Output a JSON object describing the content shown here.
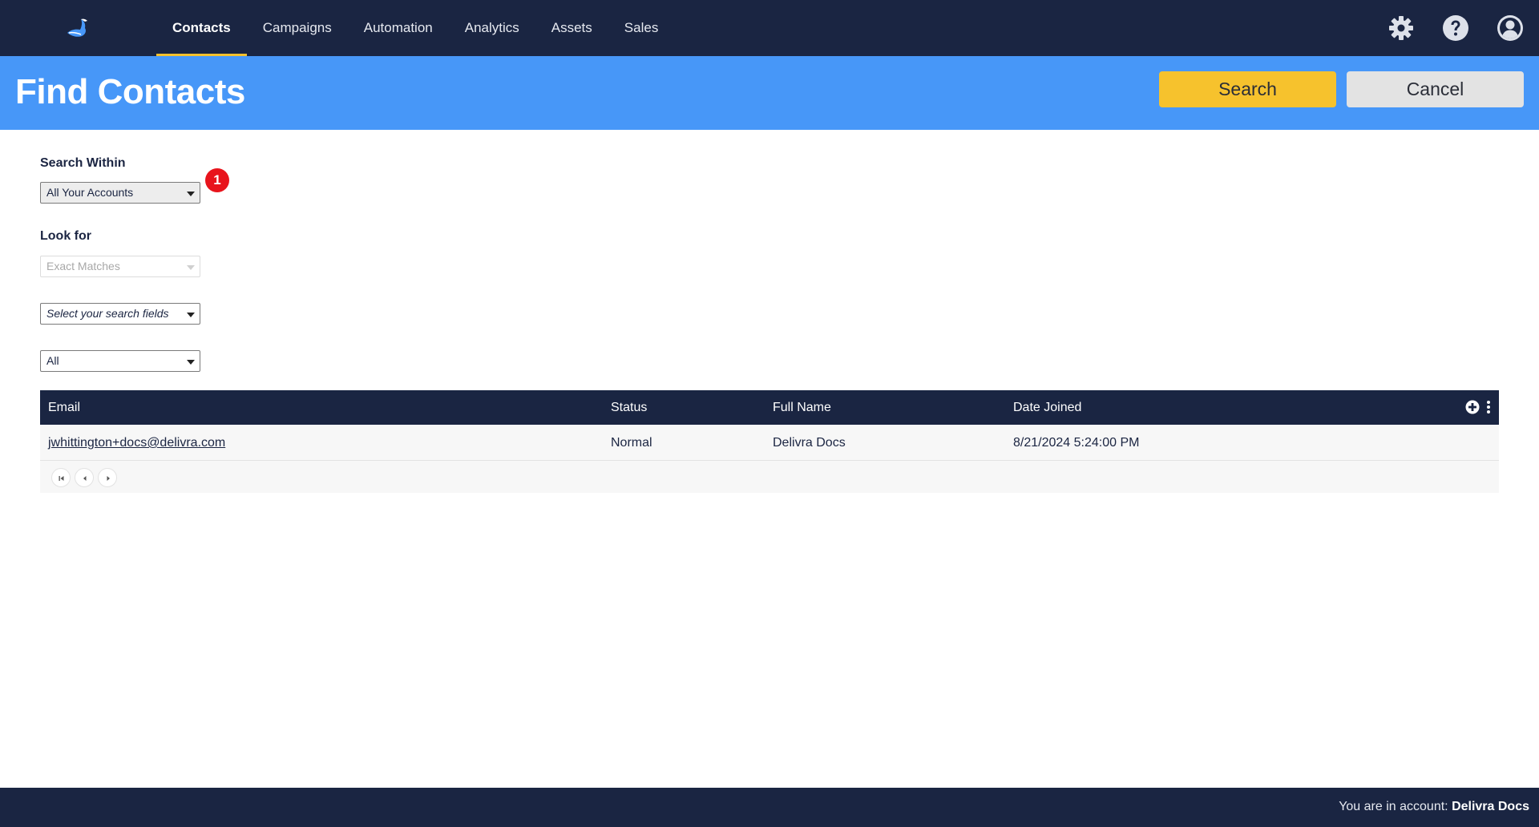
{
  "app": {
    "logo_icon": "bird-logo-icon",
    "accent_color": "#f6c22d",
    "nav_bg": "#1a2542",
    "header_bg": "#4797f8"
  },
  "nav": {
    "tabs": [
      {
        "label": "Contacts",
        "active": true
      },
      {
        "label": "Campaigns",
        "active": false
      },
      {
        "label": "Automation",
        "active": false
      },
      {
        "label": "Analytics",
        "active": false
      },
      {
        "label": "Assets",
        "active": false
      },
      {
        "label": "Sales",
        "active": false
      }
    ],
    "icons": [
      "gear-icon",
      "help-icon",
      "user-icon"
    ]
  },
  "header": {
    "title": "Find Contacts",
    "search_label": "Search",
    "cancel_label": "Cancel"
  },
  "form": {
    "search_within_label": "Search Within",
    "search_within_value": "All Your Accounts",
    "badge": "1",
    "look_for_label": "Look for",
    "look_for_value": "Exact Matches",
    "search_fields_placeholder": "Select your search fields",
    "status_filter_value": "All"
  },
  "table": {
    "columns": [
      "Email",
      "Status",
      "Full Name",
      "Date Joined"
    ],
    "rows": [
      {
        "email": "jwhittington+docs@delivra.com",
        "status": "Normal",
        "full_name": "Delivra Docs",
        "date_joined": "8/21/2024 5:24:00 PM"
      }
    ]
  },
  "footer": {
    "prefix": "You are in account:",
    "account": "Delivra Docs"
  }
}
